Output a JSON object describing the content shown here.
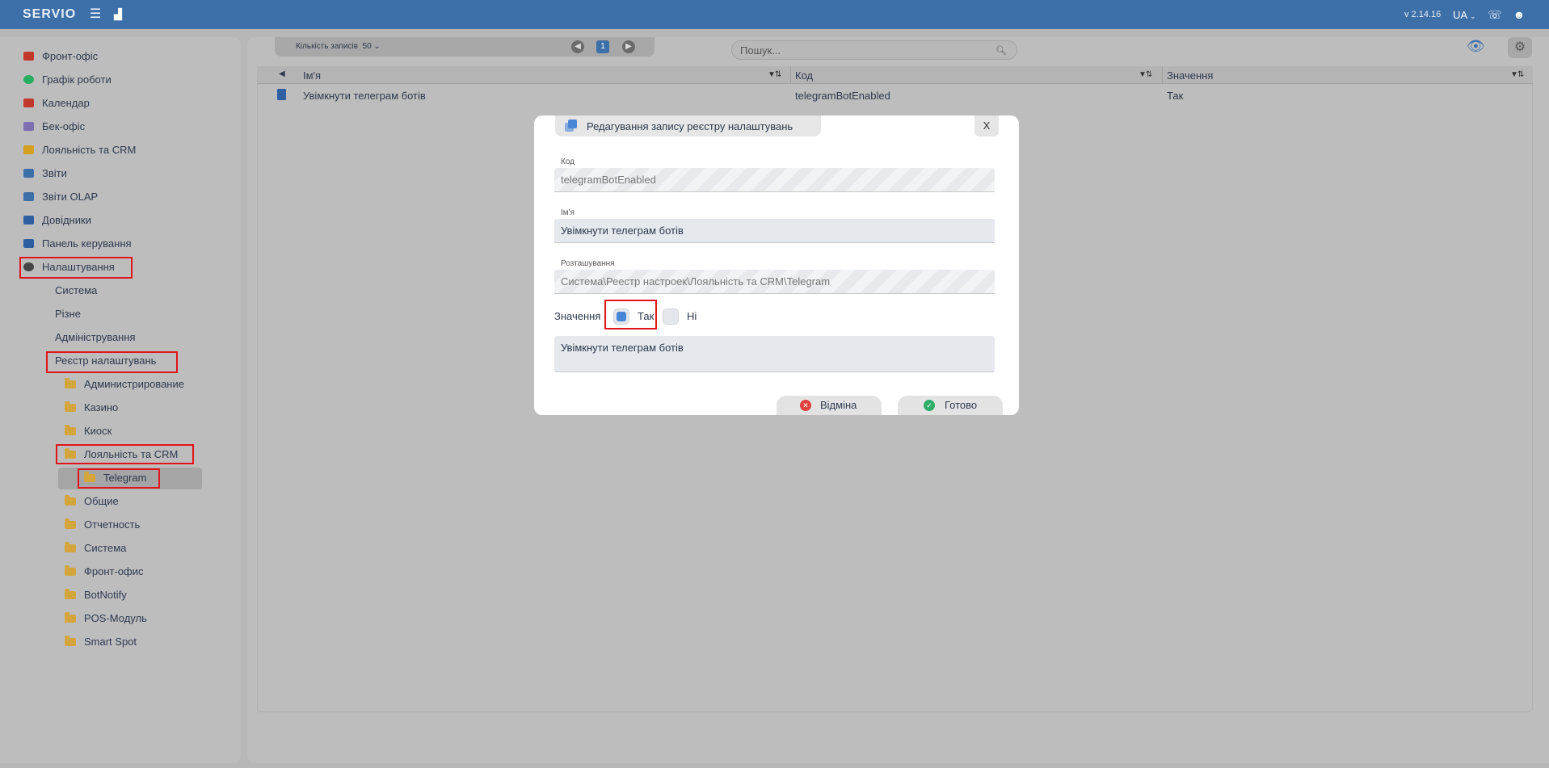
{
  "app": {
    "logo": "SERVIO",
    "version": "v 2.14.16",
    "lang": "UA"
  },
  "sidebar": {
    "items": [
      {
        "label": "Фронт-офіс",
        "icon": "briefcase-icon",
        "color": "#c0392b"
      },
      {
        "label": "Графік роботи",
        "icon": "clock-icon",
        "color": "#27ae60"
      },
      {
        "label": "Календар",
        "icon": "calendar-icon",
        "color": "#c0392b"
      },
      {
        "label": "Бек-офіс",
        "icon": "list-icon",
        "color": "#7d6fb0"
      },
      {
        "label": "Лояльність та CRM",
        "icon": "people-icon",
        "color": "#d4a020"
      },
      {
        "label": "Звіти",
        "icon": "report-icon",
        "color": "#3d6fa8"
      },
      {
        "label": "Звіти OLAP",
        "icon": "olap-report-icon",
        "color": "#3d6fa8"
      },
      {
        "label": "Довідники",
        "icon": "book-icon",
        "color": "#2f5fa0"
      },
      {
        "label": "Панель керування",
        "icon": "dashboard-icon",
        "color": "#2f5fa0"
      },
      {
        "label": "Налаштування",
        "icon": "gear-icon",
        "color": "#444444"
      }
    ],
    "sub": [
      "Система",
      "Різне",
      "Адміністрування",
      "Реєстр налаштувань"
    ],
    "folders": [
      "Администрирование",
      "Казино",
      "Киоск",
      "Лояльність та CRM",
      "Telegram",
      "Общие",
      "Отчетность",
      "Система",
      "Фронт-офис",
      "BotNotify",
      "POS-Модуль",
      "Smart Spot"
    ]
  },
  "toolbar": {
    "records_label": "Кількість записів",
    "records_value": "50",
    "page": "1",
    "search_placeholder": "Пошук..."
  },
  "grid": {
    "columns": [
      "Ім'я",
      "Код",
      "Значення"
    ],
    "rows": [
      {
        "name": "Увімкнути телеграм ботів",
        "code": "telegramBotEnabled",
        "value": "Так"
      }
    ]
  },
  "modal": {
    "title": "Редагування запису реєстру налаштувань",
    "close": "X",
    "code_label": "Код",
    "code_value": "telegramBotEnabled",
    "name_label": "Ім'я",
    "name_value": "Увімкнути телеграм ботів",
    "location_label": "Розташування",
    "location_value": "Система\\Реестр настроек\\Лояльність та CRM\\Telegram",
    "value_label": "Значення",
    "yes_label": "Так",
    "no_label": "Ні",
    "description": "Увімкнути телеграм ботів",
    "cancel_label": "Відміна",
    "done_label": "Готово"
  }
}
